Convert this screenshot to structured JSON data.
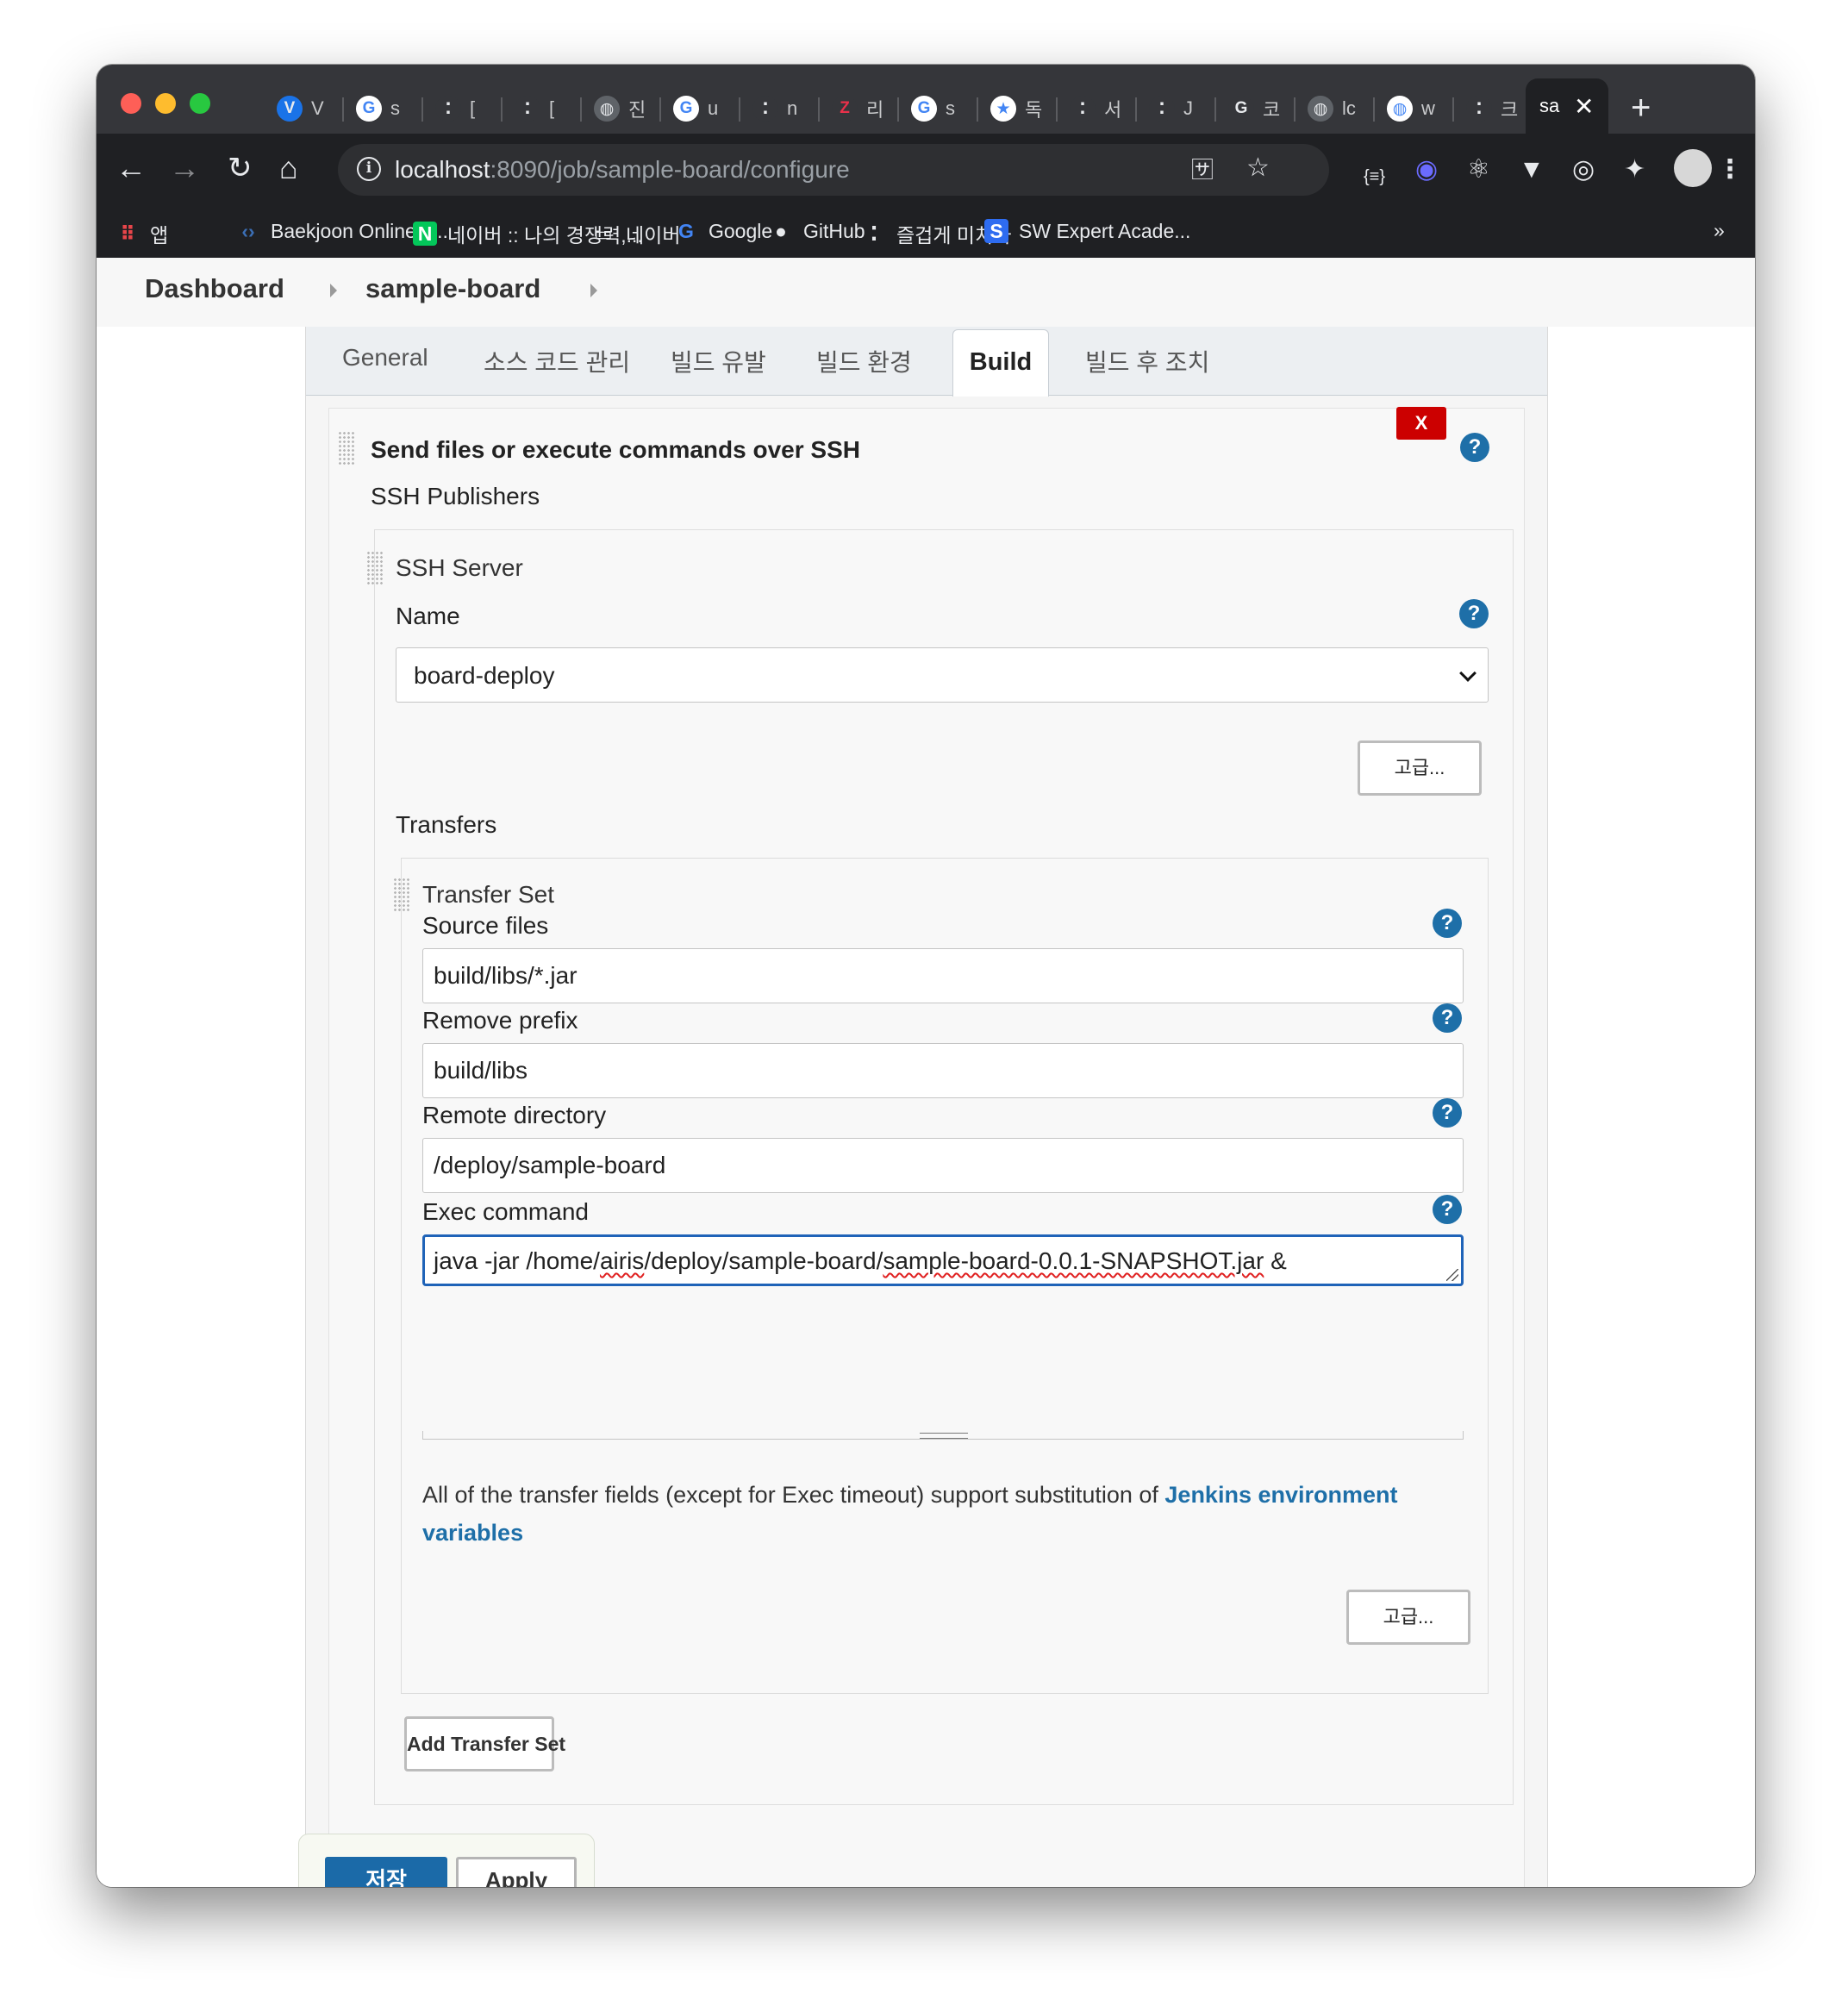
{
  "browser": {
    "tabs": [
      {
        "title": "V",
        "icon": "V",
        "icon_bg": "#1a73e8"
      },
      {
        "title": "s",
        "icon": "G",
        "icon_bg": "#ffffff"
      },
      {
        "title": "[",
        "icon": "⁚",
        "icon_bg": "#35363a"
      },
      {
        "title": "[",
        "icon": "⁚",
        "icon_bg": "#35363a"
      },
      {
        "title": "진",
        "icon": "◍",
        "icon_bg": "#5f6368"
      },
      {
        "title": "u",
        "icon": "G",
        "icon_bg": "#ffffff"
      },
      {
        "title": "n",
        "icon": "⁚",
        "icon_bg": "#35363a"
      },
      {
        "title": "리",
        "icon": "Z",
        "icon_bg": "#35363a"
      },
      {
        "title": "s",
        "icon": "G",
        "icon_bg": "#ffffff"
      },
      {
        "title": "독",
        "icon": "★",
        "icon_bg": "#ffffff"
      },
      {
        "title": "서",
        "icon": "⁚",
        "icon_bg": "#35363a"
      },
      {
        "title": "J",
        "icon": "⁚",
        "icon_bg": "#35363a"
      },
      {
        "title": "코",
        "icon": "G",
        "icon_bg": "#35363a"
      },
      {
        "title": "lc",
        "icon": "◍",
        "icon_bg": "#5f6368"
      },
      {
        "title": "w",
        "icon": "◍",
        "icon_bg": "#ffffff"
      },
      {
        "title": "크",
        "icon": "⁚",
        "icon_bg": "#35363a"
      }
    ],
    "active_tab": {
      "title": "sa",
      "close": "✕"
    },
    "new_tab": "+",
    "url": {
      "host": "localhost",
      "rest": ":8090/job/sample-board/configure"
    },
    "bookmarks": [
      {
        "label": "앱",
        "icon": "apps-grid-icon"
      },
      {
        "label": "Baekjoon Online J...",
        "icon": "code-icon"
      },
      {
        "label": "네이버 :: 나의 경쟁력,...",
        "icon": "naver-icon"
      },
      {
        "label": "네이버",
        "icon": "folder-icon"
      },
      {
        "label": "Google",
        "icon": "google-icon"
      },
      {
        "label": "GitHub",
        "icon": "github-icon"
      },
      {
        "label": "즐겁게 미치자",
        "icon": "dots-icon"
      },
      {
        "label": "SW Expert Acade...",
        "icon": "swea-icon"
      }
    ],
    "bookmarks_more": "»"
  },
  "breadcrumb": {
    "items": [
      "Dashboard",
      "sample-board"
    ]
  },
  "config_tabs": [
    "General",
    "소스 코드 관리",
    "빌드 유발",
    "빌드 환경",
    "Build",
    "빌드 후 조치"
  ],
  "build_step": {
    "title": "Send files or execute commands over SSH",
    "delete": "X",
    "help": "?",
    "publishers_label": "SSH Publishers",
    "server_label": "SSH Server",
    "name_label": "Name",
    "name_value": "board-deploy",
    "advanced": "고급...",
    "transfers_label": "Transfers",
    "transfer_set_label": "Transfer Set",
    "source_files_label": "Source files",
    "source_files_value": "build/libs/*.jar",
    "remove_prefix_label": "Remove prefix",
    "remove_prefix_value": "build/libs",
    "remote_dir_label": "Remote directory",
    "remote_dir_value": "/deploy/sample-board",
    "exec_label": "Exec command",
    "exec_value": "java -jar /home/airis/deploy/sample-board/sample-board-0.0.1-SNAPSHOT.jar &",
    "note_text": "All of the transfer fields (except for Exec timeout) support substitution of ",
    "note_link": "Jenkins environment variables",
    "add_transfer": "Add Transfer Set"
  },
  "actions": {
    "save": "저장",
    "apply": "Apply"
  }
}
